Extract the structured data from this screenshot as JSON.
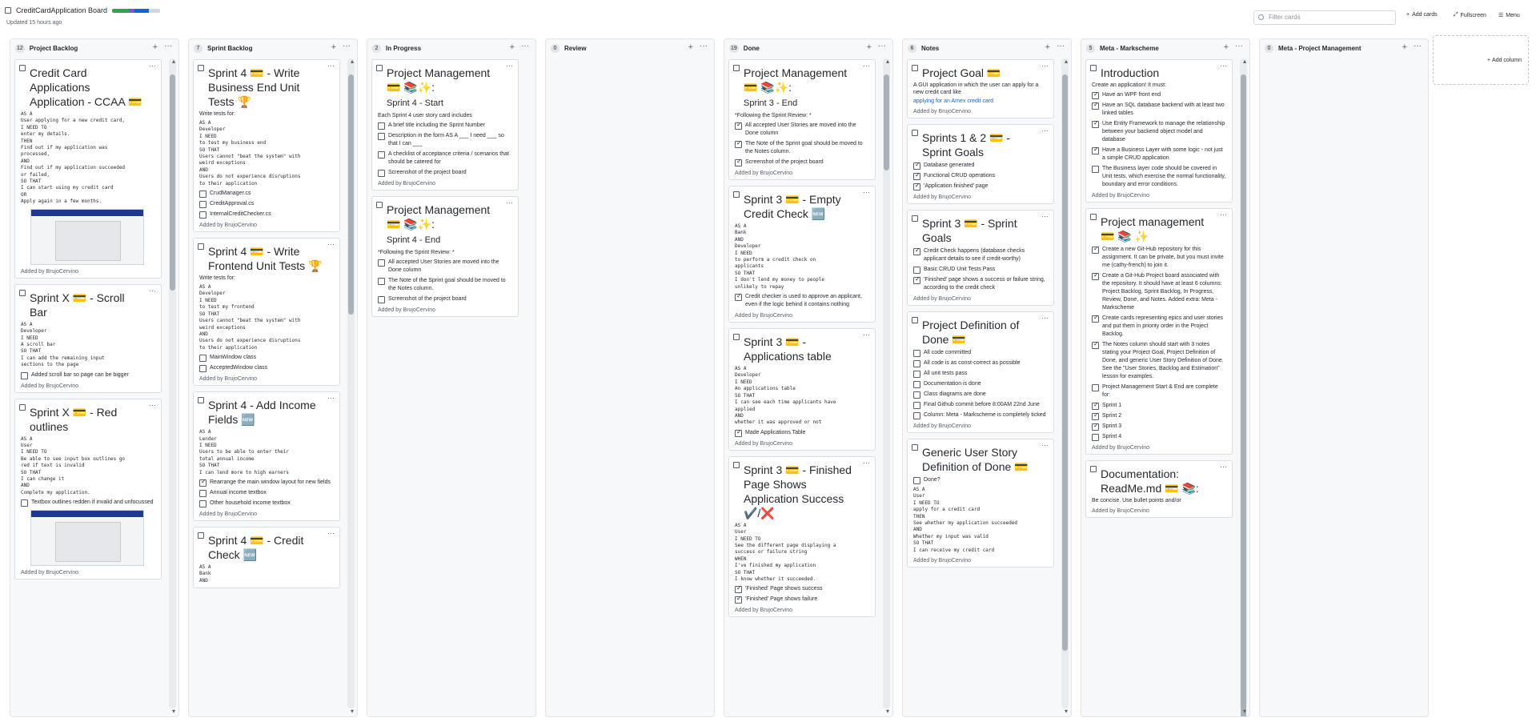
{
  "app": {
    "title": "CreditCardApplication Board",
    "updated": "Updated 15 hours ago",
    "progress_colors": [
      "#2da44e",
      "#8250df",
      "#0969da",
      "#d0d7de"
    ]
  },
  "toolbar": {
    "filter_placeholder": "Filter cards",
    "add_cards": "Add cards",
    "fullscreen": "Fullscreen",
    "menu": "Menu",
    "add_column": "Add column"
  },
  "colors": {
    "accent": "#0969da",
    "check": "#24292f",
    "border": "#d8dee4"
  },
  "columns": [
    {
      "name": "Project Backlog",
      "count": "12"
    },
    {
      "name": "Sprint Backlog",
      "count": "7"
    },
    {
      "name": "In Progress",
      "count": "2"
    },
    {
      "name": "Review",
      "count": "0"
    },
    {
      "name": "Done",
      "count": "19"
    },
    {
      "name": "Notes",
      "count": "6"
    },
    {
      "name": "Meta - Markscheme",
      "count": "5"
    },
    {
      "name": "Meta - Project Management",
      "count": "0"
    }
  ],
  "added_by": "Added by BrujoCervino",
  "c0": [
    {
      "title": "Credit Card Applications Application - CCAA 💳",
      "body": "AS A\nUser applying for a new credit card,\nI NEED TO\nenter my details.\nTHEN\nFind out if my application was\nprocessed,\nAND\nFind out if my application succeeded\nor failed,\nSO THAT\nI can start using my credit card\nOR\nApply again in a few months."
    },
    {
      "title": "Sprint X 💳 - Scroll Bar",
      "body": "AS A\nDeveloper\nI NEED\nA scroll bar\nSO THAT\nI can add the remaining input\nsections to the page",
      "checks": [
        {
          "t": "Added scroll bar so page can be bigger",
          "on": false
        }
      ]
    },
    {
      "title": "Sprint X 💳 - Red outlines",
      "body": "AS A\nUser\nI NEED TO\nBe able to see input box outlines go\nred if text is invalid\nSO THAT\nI can change it\nAND\nComplete my application.",
      "checks": [
        {
          "t": "Textbox outlines redden if invalid and unfocussed",
          "on": false
        }
      ]
    }
  ],
  "c1": [
    {
      "title": "Sprint 4 💳 - Write Business End Unit Tests 🏆",
      "body": "AS A\nDeveloper\nI NEED\nto test my business end\nSO THAT\nUsers cannot \"beat the system\" with\nweird exceptions\nAND\nUsers do not experience disruptions\nto their application",
      "lead": "Write tests for:",
      "checks": [
        {
          "t": "CrudManager.cs",
          "on": false
        },
        {
          "t": "CreditApproval.cs",
          "on": false
        },
        {
          "t": "InternalCreditChecker.cs",
          "on": false
        }
      ]
    },
    {
      "title": "Sprint 4 💳 - Write Frontend Unit Tests 🏆",
      "body": "AS A\nDeveloper\nI NEED\nto test my frontend\nSO THAT\nUsers cannot \"beat the system\" with\nweird exceptions\nAND\nUsers do not experience disruptions\nto their application",
      "lead": "Write tests for:",
      "checks": [
        {
          "t": "MainWindow class",
          "on": false
        },
        {
          "t": "AcceptedWindow class",
          "on": false
        }
      ]
    },
    {
      "title": "Sprint 4 - Add Income Fields 🆕",
      "body": "AS A\nLender\nI NEED\nUsers to be able to enter their\ntotal annual income\nSO THAT\nI can lend more to high earners",
      "checks": [
        {
          "t": "Rearrange the main window layout for new fields",
          "on": true
        },
        {
          "t": "Annual income textbox",
          "on": false
        },
        {
          "t": "Other household income textbox",
          "on": false
        }
      ]
    },
    {
      "title": "Sprint 4 💳 - Credit Check 🆕",
      "body": "AS A\nBank\nAND"
    }
  ],
  "c2": [
    {
      "title": "Project Management 💳 📚✨:",
      "sub": "Sprint 4 - Start",
      "lead": "Each Sprint 4 user story card includes",
      "checks": [
        {
          "t": "A brief title including the Sprint Number",
          "on": false
        },
        {
          "t": "Description in the form AS A ___ I need ___ so that I can ___",
          "on": false
        },
        {
          "t": "A checklist of acceptance criteria / scenarios that should be catered for",
          "on": false
        },
        {
          "t": "Screenshot of the project board",
          "on": false
        }
      ]
    },
    {
      "title": "Project Management 💳 📚✨:",
      "sub": "Sprint 4 - End",
      "lead": "*Following the Sprint Review: *",
      "checks": [
        {
          "t": "All accepted User Stories are moved into the Done column",
          "on": false
        },
        {
          "t": "The Note of the Sprint goal should be moved to the Notes column.",
          "on": false
        },
        {
          "t": "Screenshot of the project board",
          "on": false
        }
      ]
    }
  ],
  "c4": [
    {
      "title": "Project Management 💳 📚✨:",
      "sub": "Sprint 3 - End",
      "lead": "*Following the Sprint Review: *",
      "checks": [
        {
          "t": "All accepted User Stories are moved into the Done column",
          "on": true
        },
        {
          "t": "The Note of the Sprint goal should be moved to the Notes column.",
          "on": true
        },
        {
          "t": "Screenshot of the project board",
          "on": true
        }
      ]
    },
    {
      "title": "Sprint 3 💳 - Empty Credit Check 🆕",
      "body": "AS A\nBank\nAND\nDeveloper\nI NEED\nto perform a credit check on\napplicants\nSO THAT\nI don't lend my money to people\nunlikely to repay",
      "checks": [
        {
          "t": "Credit checker is used to approve an applicant, even if the logic behind it contains nothing",
          "on": true
        }
      ]
    },
    {
      "title": "Sprint 3 💳 - Applications table",
      "body": "AS A\nDeveloper\nI NEED\nAn applications table\nSO THAT\nI can see each time applicants have\napplied\nAND\nwhether it was approved or not",
      "checks": [
        {
          "t": "Made Applications Table",
          "on": true
        }
      ]
    },
    {
      "title": "Sprint 3 💳 - Finished Page Shows Application Success ✔️/❌",
      "body": "AS A\nUser\nI NEED TO\nSee the different page displaying a\nsuccess or failure string\nWHEN\nI've finished my application\nSO THAT\nI know whether it succeeded.",
      "checks": [
        {
          "t": "'Finished' Page shows success",
          "on": true
        },
        {
          "t": "'Finished' Page shows failure",
          "on": true
        }
      ]
    }
  ],
  "c5": [
    {
      "title": "Project Goal 💳",
      "lead": "A GUI application in which the user can apply for a new credit card like",
      "link": "applying for an Amex credit card"
    },
    {
      "title": "Sprints 1 & 2 💳 - Sprint Goals",
      "checks": [
        {
          "t": "Database generated",
          "on": true
        },
        {
          "t": "Functional CRUD operations",
          "on": true
        },
        {
          "t": "'Application finished' page",
          "on": true
        }
      ]
    },
    {
      "title": "Sprint 3 💳 - Sprint Goals",
      "checks": [
        {
          "t": "Credit Check happens (database checks applicant details to see if credit-worthy)",
          "on": true
        },
        {
          "t": "Basic CRUD Unit Tests Pass",
          "on": false
        },
        {
          "t": "'Finished' page shows a success or failure string, according to the credit check",
          "on": true
        }
      ]
    },
    {
      "title": "Project Definition of Done 💳",
      "checks": [
        {
          "t": "All code committed",
          "on": false
        },
        {
          "t": "All code is as const-correct as possible",
          "on": false
        },
        {
          "t": "All unit tests pass",
          "on": false
        },
        {
          "t": "Documentation is done",
          "on": false
        },
        {
          "t": "Class diagrams are done",
          "on": false
        },
        {
          "t": "Final Github commit before 8:00AM 22nd June",
          "on": false
        },
        {
          "t": "Column: Meta - Markscheme is completely ticked",
          "on": false
        }
      ]
    },
    {
      "title": "Generic User Story Definition of Done 💳",
      "checks": [
        {
          "t": "Done?",
          "on": false
        }
      ],
      "body": "AS A\nUser\nI NEED TO\napply for a credit card\nTHEN\nSee whether my application succeeded\nAND\nWhether my input was valid\nSO THAT\nI can receive my credit card"
    }
  ],
  "c6": [
    {
      "title": "Introduction",
      "lead": "Create an application! It must:",
      "checks": [
        {
          "t": "Have an WPF front end",
          "on": true
        },
        {
          "t": "Have an SQL database backend with at least two linked tables",
          "on": true
        },
        {
          "t": "Use Entity Framework to manage the relationship between your backend object model and database",
          "on": true
        },
        {
          "t": "Have a Business Layer with some logic - not just a simple CRUD application",
          "on": true
        },
        {
          "t": "The Business layer code should be covered in Unit tests, which exercise the normal functionality, boundary and error conditions.",
          "on": false
        }
      ]
    },
    {
      "title": "Project management 💳 📚 ✨",
      "checks": [
        {
          "t": "Create a new Git-Hub repository for this assignment. It can be private, but you must invite me (cathy-french) to join it.",
          "on": true
        },
        {
          "t": "Create a Git-Hub Project board associated with the repository. It should have at least 6 columns: Project Backlog, Sprint Backlog, In Progress, Review, Done, and Notes. Added extra: Meta - Markscheme",
          "on": true
        },
        {
          "t": "Create cards representing epics and user stories and put them in priority order in the Project Backlog.",
          "on": true
        },
        {
          "t": "The Notes column should start with 3 notes stating your Project Goal, Project Definition of Done, and generic User Story Definition of Done. See the \"User Stories, Backlog and Estimation\" lesson for examples.",
          "on": true
        },
        {
          "t": "Project Management Start & End are complete for:",
          "on": false
        },
        {
          "t": "Sprint 1",
          "on": true
        },
        {
          "t": "Sprint 2",
          "on": true
        },
        {
          "t": "Sprint 3",
          "on": true
        },
        {
          "t": "Sprint 4",
          "on": false
        }
      ]
    },
    {
      "title": "Documentation: ReadMe.md 💳 📚:",
      "lead": "Be concise. Use bullet points and/or"
    }
  ]
}
